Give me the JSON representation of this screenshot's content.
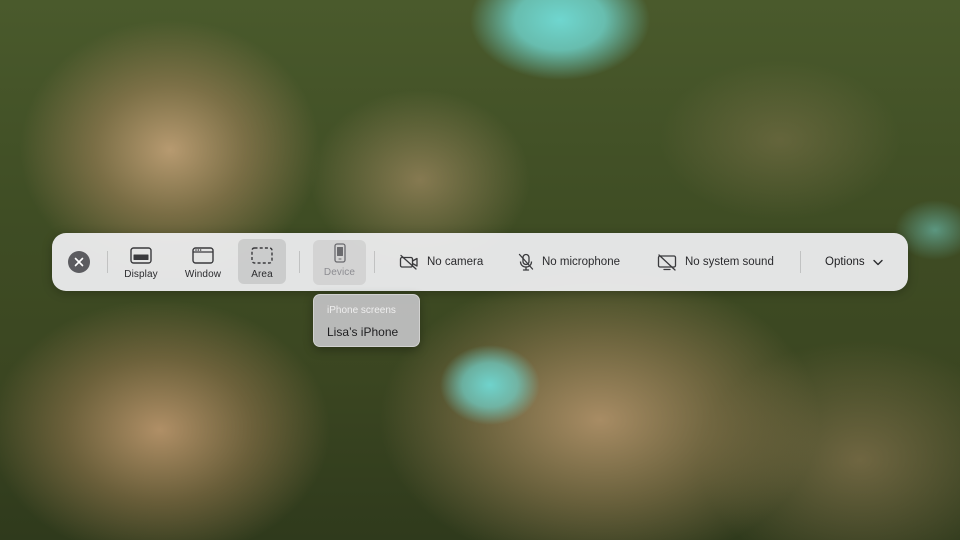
{
  "toolbar": {
    "capture_modes": [
      {
        "label": "Display",
        "icon": "display-icon",
        "selected": false
      },
      {
        "label": "Window",
        "icon": "window-icon",
        "selected": false
      },
      {
        "label": "Area",
        "icon": "area-selection-icon",
        "selected": true
      },
      {
        "label": "Device",
        "icon": "iphone-icon",
        "selected": false
      }
    ],
    "camera_label": "No camera",
    "microphone_label": "No microphone",
    "system_sound_label": "No system sound",
    "options_label": "Options"
  },
  "device_menu": {
    "header": "iPhone screens",
    "items": [
      "Lisa’s iPhone"
    ]
  },
  "colors": {
    "toolbar_bg": "#eeeef0",
    "close_button": "#5c5c60",
    "text": "#2b2b2e",
    "muted_text": "#8d8d92"
  }
}
